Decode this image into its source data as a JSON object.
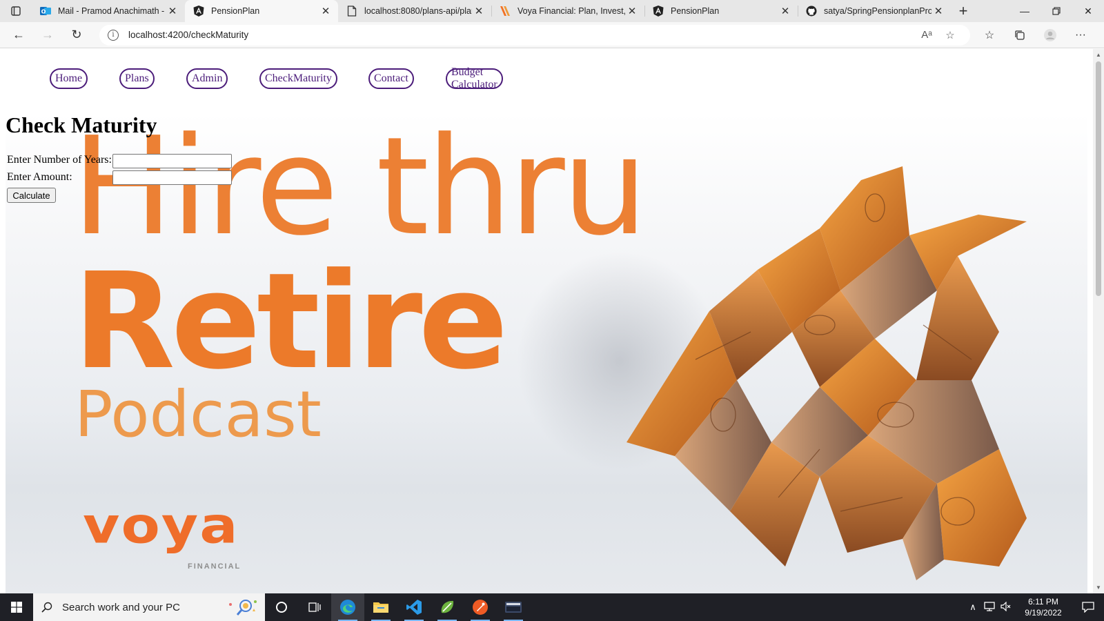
{
  "browser": {
    "tabs": [
      {
        "title": "Mail - Pramod Anachimath - C",
        "favicon": "outlook-icon",
        "active": false
      },
      {
        "title": "PensionPlan",
        "favicon": "angular-icon",
        "active": true
      },
      {
        "title": "localhost:8080/plans-api/plan",
        "favicon": "page-icon",
        "active": false
      },
      {
        "title": "Voya Financial: Plan, Invest, Pr",
        "favicon": "voya-icon",
        "active": false
      },
      {
        "title": "PensionPlan",
        "favicon": "angular-icon",
        "active": false
      },
      {
        "title": "satya/SpringPensionplanProje",
        "favicon": "github-icon",
        "active": false
      }
    ],
    "url": "localhost:4200/checkMaturity",
    "read_aloud_label": "Aᵃ"
  },
  "nav": {
    "links": [
      "Home",
      "Plans",
      "Admin",
      "CheckMaturity",
      "Contact",
      "Budget Calculator"
    ],
    "color": "#4b1c7a"
  },
  "page": {
    "title": "Check Maturity",
    "years_label": "Enter Number of Years:",
    "amount_label": "Enter Amount:",
    "calculate_label": "Calculate"
  },
  "hero": {
    "line1": "Hire thru",
    "line2": "Retire",
    "line3": "Podcast",
    "brand": "voya",
    "brand_sub": "FINANCIAL",
    "accent": "#ec7a2a"
  },
  "taskbar": {
    "search_placeholder": "Search work and your PC",
    "time": "6:11 PM",
    "date": "9/19/2022"
  }
}
